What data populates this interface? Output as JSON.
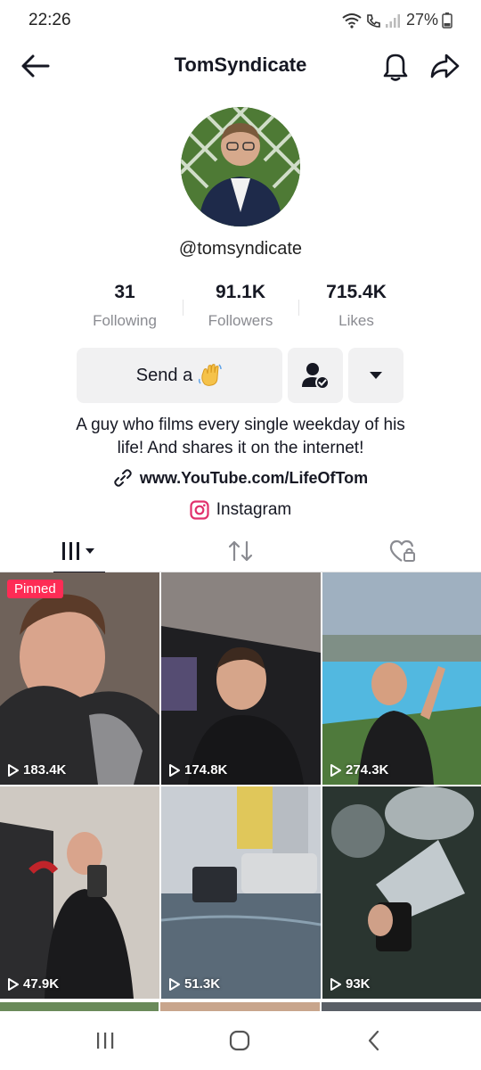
{
  "status_bar": {
    "time": "22:26",
    "battery": "27%"
  },
  "header": {
    "title": "TomSyndicate"
  },
  "profile": {
    "username": "@tomsyndicate",
    "stats": [
      {
        "value": "31",
        "label": "Following"
      },
      {
        "value": "91.1K",
        "label": "Followers"
      },
      {
        "value": "715.4K",
        "label": "Likes"
      }
    ],
    "send_label": "Send a",
    "bio_line1": "A guy who films every single weekday of his",
    "bio_line2": "life! And shares it on the internet!",
    "link": "www.YouTube.com/LifeOfTom",
    "instagram": "Instagram"
  },
  "grid": {
    "pinned_label": "Pinned",
    "videos": [
      {
        "views": "183.4K"
      },
      {
        "views": "174.8K"
      },
      {
        "views": "274.3K"
      },
      {
        "views": "47.9K"
      },
      {
        "views": "51.3K"
      },
      {
        "views": "93K"
      }
    ]
  },
  "colors": {
    "accent": "#fe2c55",
    "button_bg": "#f1f1f2",
    "muted": "#8a8b91"
  }
}
